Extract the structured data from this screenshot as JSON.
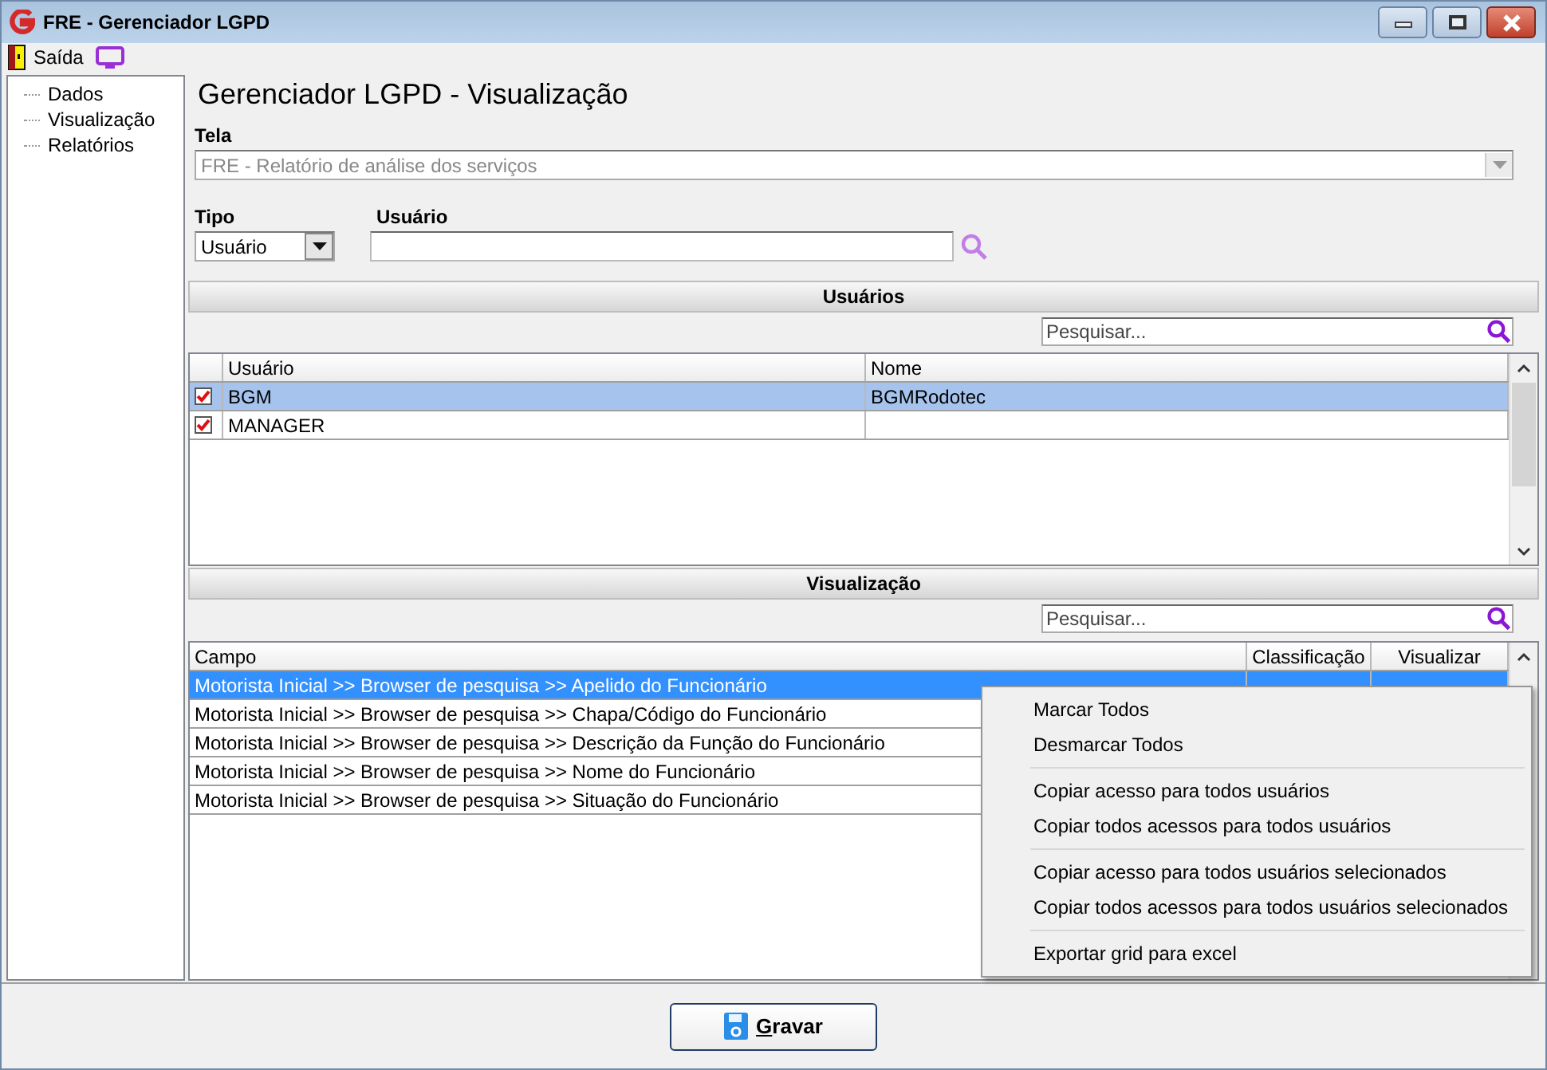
{
  "window": {
    "title": "FRE - Gerenciador LGPD"
  },
  "toolbar": {
    "exit_label": "Saída"
  },
  "sidebar": {
    "items": [
      {
        "label": "Dados"
      },
      {
        "label": "Visualização"
      },
      {
        "label": "Relatórios"
      }
    ]
  },
  "heading": "Gerenciador LGPD - Visualização",
  "tela": {
    "label": "Tela",
    "value": "FRE - Relatório de análise dos serviços",
    "disabled": true
  },
  "tipo": {
    "label": "Tipo",
    "value": "Usuário"
  },
  "usuario": {
    "label": "Usuário"
  },
  "users": {
    "title": "Usuários",
    "search_placeholder": "Pesquisar...",
    "columns": [
      "Usuário",
      "Nome"
    ],
    "rows": [
      {
        "checked": true,
        "usuario": "BGM",
        "nome": "BGMRodotec",
        "selected": true
      },
      {
        "checked": true,
        "usuario": "MANAGER",
        "selected": false
      }
    ]
  },
  "visualizacao": {
    "title": "Visualização",
    "search_placeholder": "Pesquisar...",
    "columns": [
      "Campo",
      "Classificação",
      "Visualizar"
    ],
    "rows": [
      {
        "campo": "Motorista Inicial >> Browser de pesquisa >> Apelido do Funcionário",
        "selected": true
      },
      {
        "campo": "Motorista Inicial >> Browser de pesquisa >> Chapa/Código do Funcionário",
        "selected": false
      },
      {
        "campo": "Motorista Inicial >> Browser de pesquisa >> Descrição da Função do Funcionário",
        "selected": false
      },
      {
        "campo": "Motorista Inicial >> Browser de pesquisa >> Nome do Funcionário",
        "selected": false
      },
      {
        "campo": "Motorista Inicial >> Browser de pesquisa >> Situação do Funcionário",
        "selected": false
      }
    ]
  },
  "context_menu": {
    "groups": [
      [
        "Marcar Todos",
        "Desmarcar Todos"
      ],
      [
        "Copiar acesso para todos usuários",
        "Copiar todos acessos para todos usuários"
      ],
      [
        "Copiar acesso para todos usuários selecionados",
        "Copiar todos acessos para todos usuários selecionados"
      ],
      [
        "Exportar grid para excel"
      ]
    ]
  },
  "save_button": {
    "label": "Gravar"
  }
}
